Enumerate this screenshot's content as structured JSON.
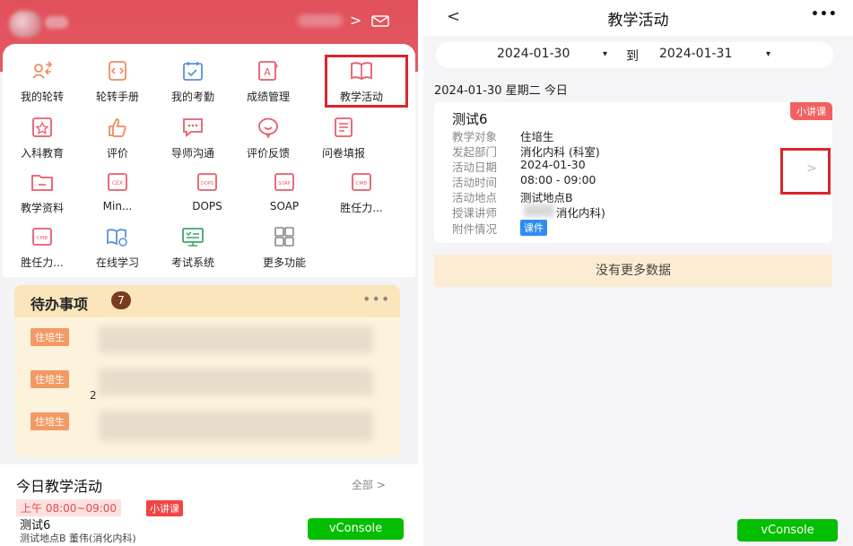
{
  "left": {
    "menu": [
      {
        "label": "我的轮转",
        "icon": "rotation-icon"
      },
      {
        "label": "轮转手册",
        "icon": "manual-icon"
      },
      {
        "label": "我的考勤",
        "icon": "attendance-icon"
      },
      {
        "label": "成绩管理",
        "icon": "grade-icon"
      },
      {
        "label": "教学活动",
        "icon": "book-icon"
      },
      {
        "label": "入科教育",
        "icon": "entry-education-icon"
      },
      {
        "label": "评价",
        "icon": "thumbs-up-icon"
      },
      {
        "label": "导师沟通",
        "icon": "chat-icon"
      },
      {
        "label": "评价反馈",
        "icon": "feedback-icon"
      },
      {
        "label": "问卷填报",
        "icon": "questionnaire-icon"
      },
      {
        "label": "教学资料",
        "icon": "folder-icon"
      },
      {
        "label": "Min...",
        "icon": "cex-icon",
        "badge": "CEX"
      },
      {
        "label": "DOPS",
        "icon": "dops-icon",
        "badge": "DOPS"
      },
      {
        "label": "SOAP",
        "icon": "soap-icon",
        "badge": "SOAP"
      },
      {
        "label": "胜任力...",
        "icon": "cmb-icon",
        "badge": "CMB"
      },
      {
        "label": "胜任力...",
        "icon": "cmb-icon",
        "badge": "CMB"
      },
      {
        "label": "在线学习",
        "icon": "online-learning-icon"
      },
      {
        "label": "考试系统",
        "icon": "exam-icon"
      },
      {
        "label": "更多功能",
        "icon": "more-grid-icon"
      }
    ],
    "todo": {
      "title": "待办事项",
      "count": "7",
      "more": "•••",
      "tags": [
        "住培生",
        "住培生",
        "住培生"
      ],
      "number": "2"
    },
    "today": {
      "title": "今日教学活动",
      "all": "全部 >",
      "time": "上午 08:00~09:00",
      "tag": "小讲课",
      "name": "测试6",
      "location": "测试地点B 董伟(消化内科)"
    },
    "vconsole": "vConsole",
    "header_chevron": ">"
  },
  "right": {
    "back": "<",
    "title": "教学活动",
    "more": "•••",
    "date_from": "2024-01-30",
    "date_to": "2024-01-31",
    "to_label": "到",
    "dropdown_arrow": "▾",
    "day_header": "2024-01-30 星期二 今日",
    "activity": {
      "name": "测试6",
      "type_tag": "小讲课",
      "rows": [
        {
          "label": "教学对象",
          "value": "住培生"
        },
        {
          "label": "发起部门",
          "value": "消化内科 (科室)"
        },
        {
          "label": "活动日期",
          "value": "2024-01-30"
        },
        {
          "label": "活动时间",
          "value": "08:00 - 09:00"
        },
        {
          "label": "活动地点",
          "value": "测试地点B"
        },
        {
          "label": "授课讲师",
          "value": "消化内科)"
        },
        {
          "label": "附件情况",
          "value": "课件"
        }
      ],
      "chevron": ">"
    },
    "no_more": "没有更多数据",
    "vconsole": "vConsole"
  },
  "colors": {
    "header_red": "#e0505b",
    "highlight": "#d9262c",
    "todo_bg": "#fdf2dc",
    "accent_orange": "#f39a64",
    "vconsole_green": "#04be02"
  }
}
